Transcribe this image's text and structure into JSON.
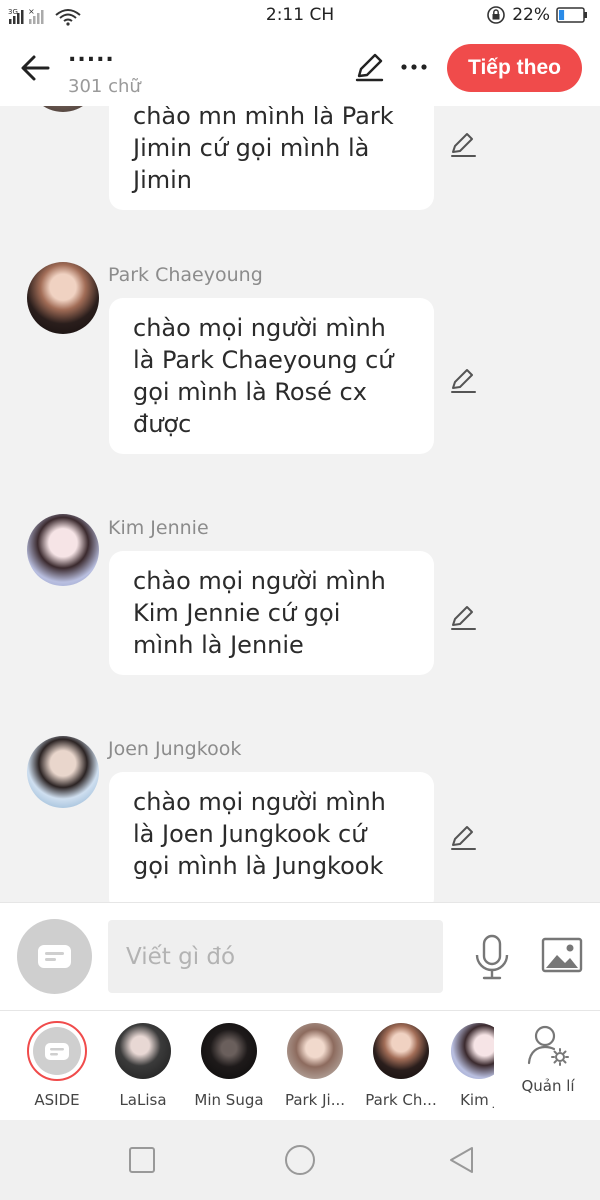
{
  "status_bar": {
    "network_left": "3G",
    "time": "2:11 CH",
    "battery_percent": "22%",
    "battery_level": 0.22
  },
  "header": {
    "title": ".....",
    "word_count": "301 chữ",
    "next_label": "Tiếp theo"
  },
  "messages": [
    {
      "name": "",
      "text": "chào mn mình là Park Jimin cứ gọi mình là Jimin",
      "lines": [
        "chào mn mình là Park",
        "Jimin cứ gọi mình là",
        "Jimin"
      ]
    },
    {
      "name": "Park Chaeyoung",
      "text": "chào mọi người mình là Park Chaeyoung cứ gọi mình là Rosé cx được",
      "lines": [
        "chào mọi người mình",
        "là Park Chaeyoung cứ",
        "gọi mình là Rosé cx",
        "được"
      ]
    },
    {
      "name": "Kim Jennie",
      "text": "chào mọi người mình Kim Jennie cứ gọi mình là Jennie",
      "lines": [
        "chào mọi người mình",
        "Kim Jennie cứ gọi",
        "mình là Jennie"
      ]
    },
    {
      "name": "Joen Jungkook",
      "text": "chào mọi người mình là Joen Jungkook cứ gọi mình là Jungkook",
      "lines": [
        "chào mọi người mình",
        "là Joen Jungkook cứ",
        "gọi mình là Jungkook"
      ]
    }
  ],
  "input": {
    "placeholder": "Viết gì đó"
  },
  "characters": [
    {
      "label": "ASIDE",
      "selected": true
    },
    {
      "label": "LaLisa"
    },
    {
      "label": "Min Suga"
    },
    {
      "label": "Park Ji..."
    },
    {
      "label": "Park Ch..."
    },
    {
      "label": "Kim J"
    }
  ],
  "manage_label": "Quản lí",
  "colors": {
    "accent": "#f04b4b",
    "background": "#f2f2f2",
    "bubble": "#ffffff",
    "muted_text": "#8c8c8c"
  },
  "icons": [
    "back-arrow-icon",
    "pencil-icon",
    "more-dots-icon",
    "microphone-icon",
    "image-icon",
    "manage-user-icon",
    "square-nav-icon",
    "circle-nav-icon",
    "triangle-back-nav-icon"
  ]
}
